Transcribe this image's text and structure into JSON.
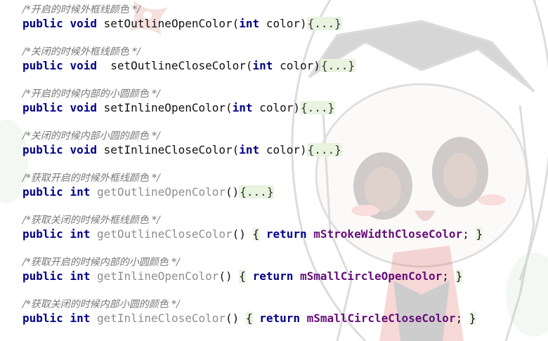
{
  "methods": [
    {
      "comment": "/*开启的时候外框线颜色 */",
      "kw1": "public",
      "kw2": "void",
      "space": " ",
      "name": "setOutlineOpenColor",
      "open": "(",
      "ptype": "int",
      "pname": " color",
      "close": ")",
      "body": "{...}"
    },
    {
      "comment": "/*关闭的时候外框线颜色 */",
      "kw1": "public",
      "kw2": "void",
      "space": "  ",
      "name": "setOutlineCloseColor",
      "open": "(",
      "ptype": "int",
      "pname": " color",
      "close": ")",
      "body": "{...}"
    },
    {
      "comment": "/*开启的时候内部的小圆颜色 */",
      "kw1": "public",
      "kw2": "void",
      "space": " ",
      "name": "setInlineOpenColor",
      "open": "(",
      "ptype": "int",
      "pname": " color",
      "close": ")",
      "body": "{...}"
    },
    {
      "comment": "/*关闭的时候内部小圆的颜色 */",
      "kw1": "public",
      "kw2": "void",
      "space": " ",
      "name": "setInlineCloseColor",
      "open": "(",
      "ptype": "int",
      "pname": " color",
      "close": ")",
      "body": "{...}"
    }
  ],
  "getters": [
    {
      "comment": "/*获取开启的时候外框线颜色 */",
      "kw1": "public",
      "kw2": "int",
      "name": "getOutlineOpenColor",
      "parens": "()",
      "body": "{...}"
    },
    {
      "comment": "/*获取关闭的时候外框线颜色 */",
      "kw1": "public",
      "kw2": "int",
      "name": "getOutlineCloseColor",
      "parens": "()",
      "lbrace": "{",
      "ret": "return",
      "field": "mStrokeWidthCloseColor",
      "semi": ";",
      "rbrace": "}"
    },
    {
      "comment": "/*获取开启的时候内部的小圆颜色 */",
      "kw1": "public",
      "kw2": "int",
      "name": "getInlineOpenColor",
      "parens": "()",
      "lbrace": "{",
      "ret": "return",
      "field": "mSmallCircleOpenColor",
      "semi": ";",
      "rbrace": "}"
    },
    {
      "comment": "/*获取关闭的时候内部小圆的颜色 */",
      "kw1": "public",
      "kw2": "int",
      "name": "getInlineCloseColor",
      "parens": "()",
      "lbrace": "{",
      "ret": "return",
      "field": "mSmallCircleCloseColor",
      "semi": ";",
      "rbrace": "}"
    }
  ],
  "colors": {
    "keyword": "#00008b",
    "comment": "#777777",
    "field": "#660e7a",
    "fold_bg": "#e8f3e0",
    "unused_method": "#8e8e8e"
  }
}
